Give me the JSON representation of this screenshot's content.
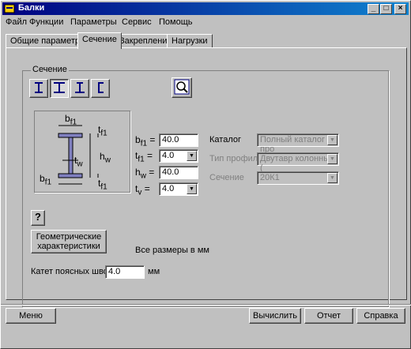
{
  "window": {
    "title": "Балки"
  },
  "menu": [
    "Файл",
    "Функции",
    "Параметры",
    "Сервис",
    "Помощь"
  ],
  "tabs": [
    "Общие параметры",
    "Сечение",
    "Закрепление",
    "Нагрузки"
  ],
  "section": {
    "group_title": "Сечение",
    "profile_buttons": [
      "i-beam-icon",
      "wide-i-beam-icon",
      "t-icon",
      "channel-icon"
    ],
    "diagram_labels": {
      "bf1_top": "b",
      "tf1_top": "t",
      "hw": "h",
      "tw": "t",
      "bf1_bottom": "b",
      "tf1_bottom": "t",
      "sub_f1": "f1",
      "sub_w": "w"
    },
    "params": [
      {
        "label": "b",
        "sub": "f1",
        "value": "40.0",
        "combo": false
      },
      {
        "label": "t",
        "sub": "f1",
        "value": "4.0",
        "combo": true
      },
      {
        "label": "h",
        "sub": "w",
        "value": "40.0",
        "combo": false
      },
      {
        "label": "t",
        "sub": "v",
        "value": "4.0",
        "combo": true
      }
    ],
    "equals": "=",
    "catalog_label": "Каталог",
    "catalog_value": "Полный каталог про",
    "profile_type_label": "Тип профиля",
    "profile_type_value": "Двутавр колонный (",
    "section_label": "Сечение",
    "section_value": "20К1",
    "help_label": "?",
    "geom_button": "Геометрические характеристики",
    "units_note": "Все размеры в   мм",
    "weld_label": "Катет поясных швов",
    "weld_value": "4.0",
    "weld_unit": "мм"
  },
  "footer": {
    "menu": "Меню",
    "calculate": "Вычислить",
    "report": "Отчет",
    "help": "Справка"
  }
}
